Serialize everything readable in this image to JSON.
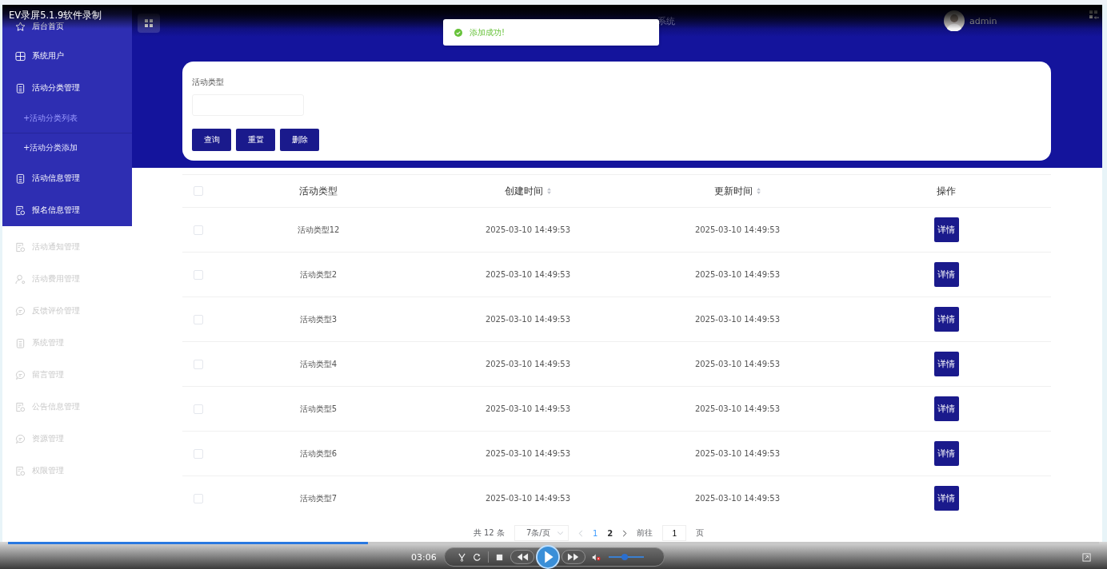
{
  "recorder_title": "EV录屏5.1.9软件录制",
  "sidebar": {
    "items": [
      {
        "label": "后台首页",
        "faded": false
      },
      {
        "label": "系统用户",
        "faded": false
      },
      {
        "label": "活动分类管理",
        "faded": false,
        "children": [
          {
            "label": "+活动分类列表",
            "selected": true
          },
          {
            "label": "+活动分类添加",
            "selected": false
          }
        ]
      },
      {
        "label": "活动信息管理",
        "faded": false
      },
      {
        "label": "报名信息管理",
        "faded": false
      },
      {
        "label": "活动通知管理",
        "faded": true
      },
      {
        "label": "活动费用管理",
        "faded": true
      },
      {
        "label": "反馈评价管理",
        "faded": true
      },
      {
        "label": "系统管理",
        "faded": true
      },
      {
        "label": "留言管理",
        "faded": true
      },
      {
        "label": "公告信息管理",
        "faded": true
      },
      {
        "label": "资源管理",
        "faded": true
      },
      {
        "label": "权限管理",
        "faded": true
      }
    ]
  },
  "header": {
    "title": "系统",
    "user": "admin"
  },
  "toast": {
    "message": "添加成功!"
  },
  "search": {
    "label": "活动类型",
    "buttons": [
      "查询",
      "重置",
      "删除"
    ]
  },
  "table": {
    "all_checked": false,
    "columns": [
      {
        "label": "活动类型",
        "sortable": false
      },
      {
        "label": "创建时间",
        "sortable": true
      },
      {
        "label": "更新时间",
        "sortable": true
      },
      {
        "label": "操作",
        "sortable": false
      }
    ],
    "rows": [
      {
        "checked": false,
        "type": "活动类型12",
        "created": "2025-03-10 14:49:53",
        "updated": "2025-03-10 14:49:53",
        "action": "详情"
      },
      {
        "checked": false,
        "type": "活动类型2",
        "created": "2025-03-10 14:49:53",
        "updated": "2025-03-10 14:49:53",
        "action": "详情"
      },
      {
        "checked": false,
        "type": "活动类型3",
        "created": "2025-03-10 14:49:53",
        "updated": "2025-03-10 14:49:53",
        "action": "详情"
      },
      {
        "checked": false,
        "type": "活动类型4",
        "created": "2025-03-10 14:49:53",
        "updated": "2025-03-10 14:49:53",
        "action": "详情"
      },
      {
        "checked": false,
        "type": "活动类型5",
        "created": "2025-03-10 14:49:53",
        "updated": "2025-03-10 14:49:53",
        "action": "详情"
      },
      {
        "checked": false,
        "type": "活动类型6",
        "created": "2025-03-10 14:49:53",
        "updated": "2025-03-10 14:49:53",
        "action": "详情"
      },
      {
        "checked": false,
        "type": "活动类型7",
        "created": "2025-03-10 14:49:53",
        "updated": "2025-03-10 14:49:53",
        "action": "详情"
      }
    ]
  },
  "pagination": {
    "total": "共 12 条",
    "page_size": "7条/页",
    "pages": [
      {
        "label": "1",
        "selected": true
      },
      {
        "label": "2",
        "selected": false
      }
    ],
    "goto_label": "前往",
    "goto_value": "1",
    "suffix": "页"
  },
  "player": {
    "time": "03:06",
    "progress": {
      "level": 0.33
    },
    "volume": {
      "level": 0.45
    },
    "muted": true
  }
}
